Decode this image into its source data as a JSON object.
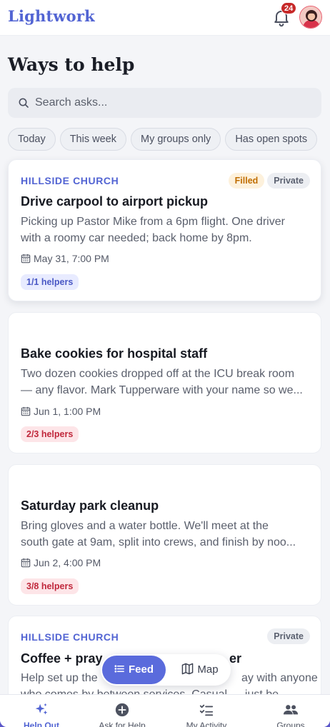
{
  "header": {
    "brand": "Lightwork",
    "notification_count": "24"
  },
  "page": {
    "title": "Ways to help"
  },
  "search": {
    "placeholder": "Search asks..."
  },
  "filters": [
    "Today",
    "This week",
    "My groups only",
    "Has open spots"
  ],
  "cards": [
    {
      "group": "HILLSIDE CHURCH",
      "badges": [
        "Filled",
        "Private"
      ],
      "title": "Drive carpool to airport pickup",
      "description": [
        "Picking up Pastor Mike from a 6pm flight. One driver",
        "with a roomy car needed; back home by 8pm."
      ],
      "date": "May 31, 7:00 PM",
      "helpers": "1/1 helpers"
    },
    {
      "group": "",
      "badges": [],
      "title": "Bake cookies for hospital staff",
      "description": [
        "Two dozen cookies dropped off at the ICU break room",
        "— any flavor. Mark Tupperware with your name so we..."
      ],
      "date": "Jun 1, 1:00 PM",
      "helpers": "2/3 helpers"
    },
    {
      "group": "",
      "badges": [],
      "title": "Saturday park cleanup",
      "description": [
        "Bring gloves and a water bottle. We'll meet at the",
        "south gate at 9am, split into crews, and finish by noo..."
      ],
      "date": "Jun 2, 4:00 PM",
      "helpers": "3/8 helpers"
    },
    {
      "group": "HILLSIDE CHURCH",
      "badges": [
        "Private"
      ],
      "title": "Coffee + pray",
      "title_tail": "er",
      "description": [
        "Help set up the",
        "ay with anyone",
        "who comes by between services. Casual — just be"
      ]
    }
  ],
  "view_toggle": {
    "feed": "Feed",
    "map": "Map",
    "active": "Feed"
  },
  "bottom_nav": [
    {
      "label": "Help Out",
      "icon": "sparkles-icon",
      "active": true
    },
    {
      "label": "Ask for Help",
      "icon": "plus-circle-icon",
      "active": false
    },
    {
      "label": "My Activity",
      "icon": "checklist-icon",
      "active": false
    },
    {
      "label": "Groups",
      "icon": "people-icon",
      "active": false
    }
  ],
  "colors": {
    "brand": "#5264d3",
    "accent_button": "#5a6bdc",
    "notification_badge": "#c62828",
    "filled_badge": "#c06d00",
    "need_helpers": "#c0273b"
  }
}
